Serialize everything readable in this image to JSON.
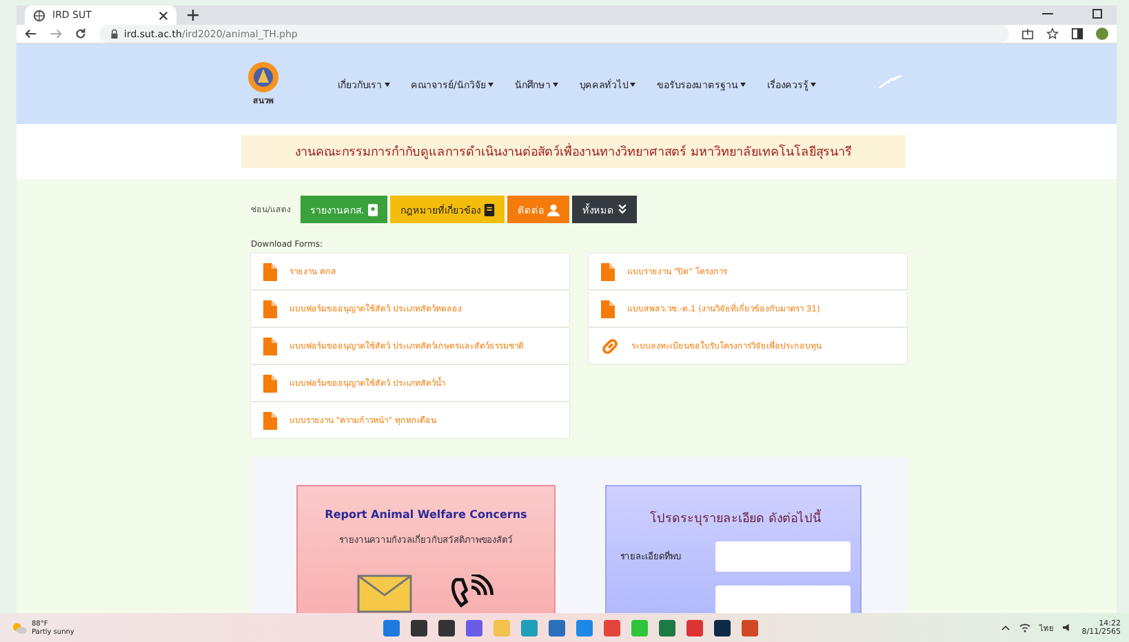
{
  "browser": {
    "tab_title": "IRD SUT",
    "url_host": "ird.sut.ac.th",
    "url_path": "/ird2020/animal_TH.php"
  },
  "header": {
    "logo_text": "สนวพ",
    "nav": [
      {
        "label": "เกี่ยวกับเรา"
      },
      {
        "label": "คณาจารย์/นักวิจัย"
      },
      {
        "label": "นักศึกษา"
      },
      {
        "label": "บุคคลทั่วไป"
      },
      {
        "label": "ขอรับรองมาตรฐาน"
      },
      {
        "label": "เรื่องควรรู้"
      }
    ]
  },
  "banner": "งานคณะกรรมการกำกับดูแลการดำเนินงานต่อสัตว์เพื่องานทางวิทยาศาสตร์ มหาวิทยาลัยเทคโนโลยีสุรนารี",
  "toggle": {
    "label": "ซ่อน/แสดง",
    "buttons": [
      {
        "label": "รายงานคกส.",
        "kind": "report",
        "color": "#3aa13d"
      },
      {
        "label": "กฎหมายที่เกี่ยวข้อง",
        "kind": "book",
        "color": "#f5bd0b"
      },
      {
        "label": "ติดต่อ",
        "kind": "user",
        "color": "#f57c0a"
      },
      {
        "label": "ทั้งหมด",
        "kind": "chevrons",
        "color": "#343a40"
      }
    ]
  },
  "downloads": {
    "heading": "Download Forms:",
    "left": [
      {
        "label": "รายงาน คกส",
        "kind": "file"
      },
      {
        "label": "แบบฟอร์มขออนุญาตใช้สัตว์ ประเภทสัตว์ทดลอง",
        "kind": "file"
      },
      {
        "label": "แบบฟอร์มขออนุญาตใช้สัตว์ ประเภทสัตว์เกษตรและสัตว์ธรรมชาติ",
        "kind": "file"
      },
      {
        "label": "แบบฟอร์มขออนุญาตใช้สัตว์ ประเภทสัตว์น้ำ",
        "kind": "file"
      },
      {
        "label": "แบบรายงาน \"ความก้าวหน้า\" ทุกหกเดือน",
        "kind": "file"
      }
    ],
    "right": [
      {
        "label": "แบบรายงาน \"ปิด\" โครงการ",
        "kind": "file"
      },
      {
        "label": "แบบสพสว.วช.-ต.1 (งานวิจัยที่เกี่ยวข้องกับมาตรา 31)",
        "kind": "file"
      },
      {
        "label": "ระบบลงทะเบียนขอใบรับโครงการวิจัยเพื่อประกอบทุน",
        "kind": "link"
      }
    ]
  },
  "report_card": {
    "title": "Report Animal Welfare Concerns",
    "subtitle": "รายงานความกังวลเกี่ยวกับสวัสดิภาพของสัตว์"
  },
  "details_card": {
    "title": "โปรดระบุรายละเอียด ดังต่อไปนี้",
    "fields": [
      {
        "label": "รายละเอียดที่พบ"
      }
    ]
  },
  "taskbar": {
    "weather_temp": "88°F",
    "weather_text": "Partly sunny",
    "language": "ไทย",
    "time": "14:22",
    "date": "8/11/2565",
    "apps": [
      {
        "kind": "start"
      },
      {
        "kind": "search"
      },
      {
        "kind": "taskview"
      },
      {
        "kind": "chat"
      },
      {
        "kind": "folder"
      },
      {
        "kind": "edge"
      },
      {
        "kind": "store"
      },
      {
        "kind": "letter-app"
      },
      {
        "kind": "chrome"
      },
      {
        "kind": "line"
      },
      {
        "kind": "excel"
      },
      {
        "kind": "pdf"
      },
      {
        "kind": "ps"
      },
      {
        "kind": "powerpoint"
      }
    ]
  }
}
